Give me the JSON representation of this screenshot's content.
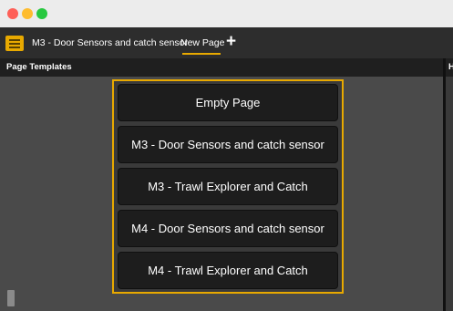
{
  "tabs": [
    {
      "label": "M3 - Door Sensors and catch sensor"
    },
    {
      "label": "New Page",
      "active": true
    }
  ],
  "add_tab_symbol": "+",
  "panel": {
    "title": "Page Templates",
    "right_title": "H"
  },
  "templates": [
    {
      "label": "Empty Page"
    },
    {
      "label": "M3 - Door Sensors and catch sensor"
    },
    {
      "label": "M3 - Trawl Explorer and Catch"
    },
    {
      "label": "M4 - Door Sensors and catch sensor"
    },
    {
      "label": "M4 - Trawl Explorer and Catch"
    }
  ],
  "colors": {
    "accent": "#e8a900",
    "tabbar": "#2d2d2d",
    "panel_header": "#1f1f1f",
    "panel_body": "#4a4a4a",
    "button": "#1d1d1d"
  }
}
